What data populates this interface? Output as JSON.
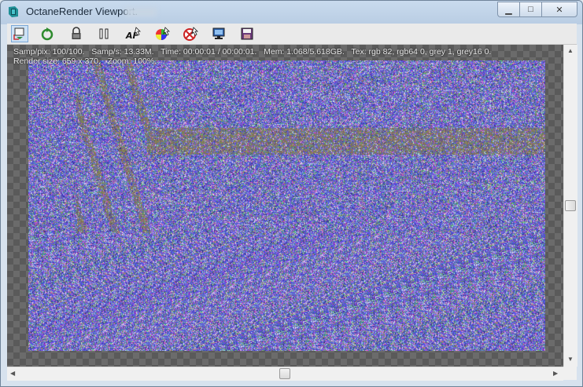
{
  "window": {
    "title": "OctaneRender Viewport.",
    "minimize_glyph": "▁",
    "maximize_glyph": "□",
    "close_glyph": "✕"
  },
  "toolbar": {
    "buttons": [
      {
        "name": "recenter-view-icon",
        "active": true
      },
      {
        "name": "restart-render-icon"
      },
      {
        "name": "lock-icon"
      },
      {
        "name": "pause-icon"
      },
      {
        "name": "focus-picker-icon"
      },
      {
        "name": "white-balance-picker-icon"
      },
      {
        "name": "material-picker-icon"
      },
      {
        "name": "region-render-icon"
      },
      {
        "name": "save-image-icon"
      }
    ]
  },
  "stats": {
    "line1": "Samp/pix: 100/100.   Samp/s: 13.33M.   Time: 00:00:01 / 00:00:01.   Mem: 1.068/5.618GB.   Tex: rgb 82, rgb64 0, grey 1, grey16 0.",
    "line2": "Render size: 659 x 370.   Zoom: 100%."
  },
  "scrollbars": {
    "up_glyph": "▲",
    "down_glyph": "▼",
    "left_glyph": "◀",
    "right_glyph": "▶"
  }
}
